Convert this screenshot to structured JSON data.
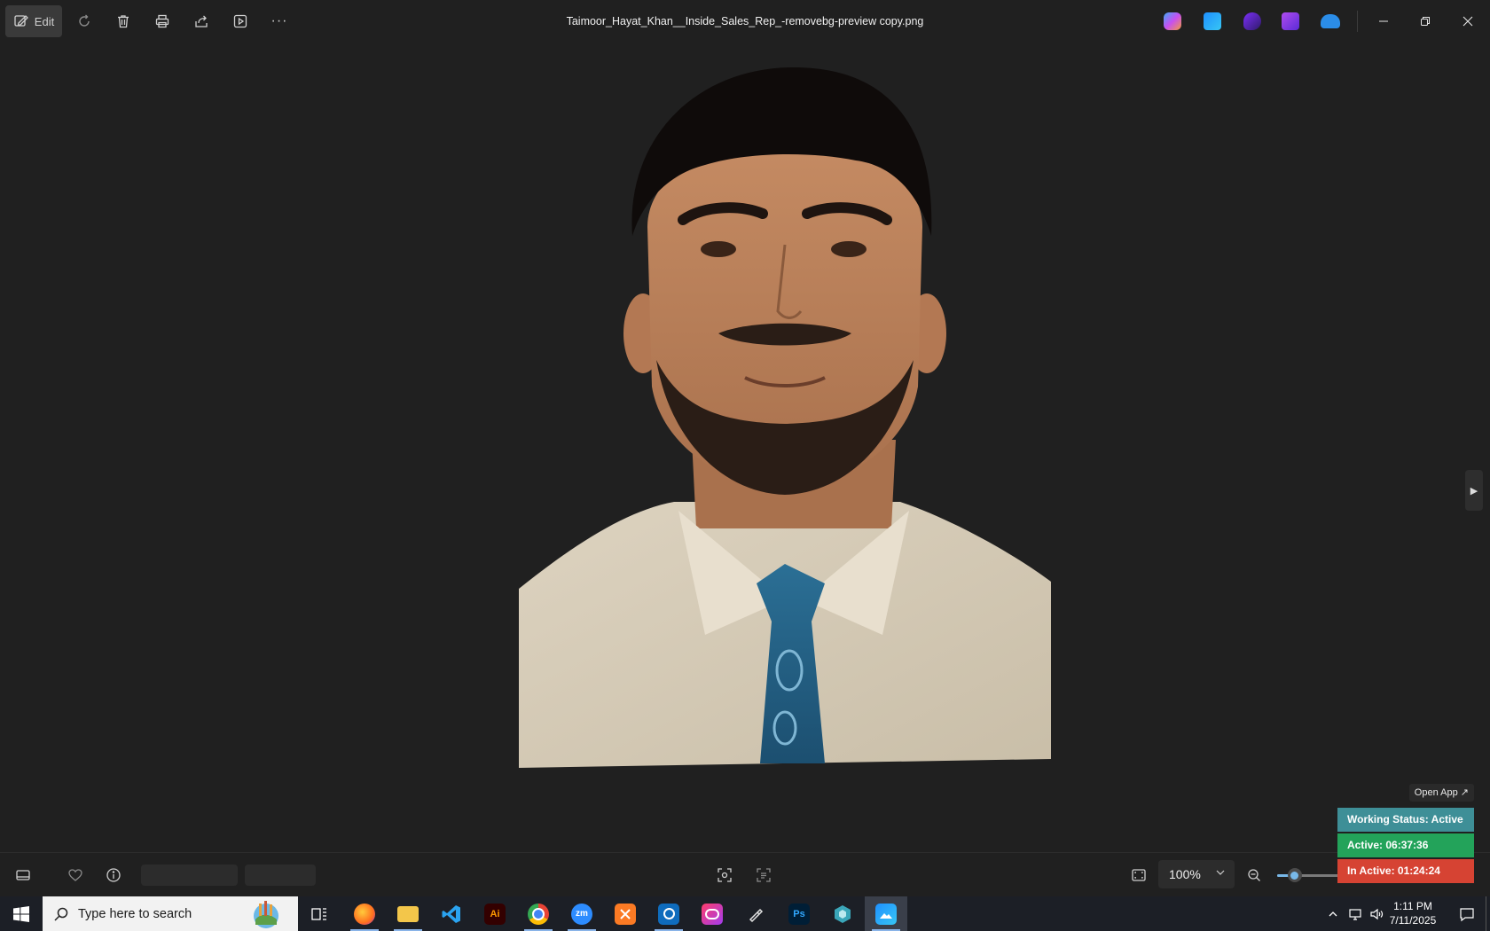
{
  "toolbar": {
    "edit_label": "Edit",
    "file_title": "Taimoor_Hayat_Khan__Inside_Sales_Rep_-removebg-preview copy.png",
    "more_label": "···"
  },
  "app_icons": [
    "copilot-icon",
    "photos-icon",
    "clipchamp-icon",
    "video-editor-icon",
    "onedrive-icon"
  ],
  "viewer": {
    "zoom_value": "100%",
    "zoom_slider_percent": 22
  },
  "widget": {
    "open_app": "Open App ↗",
    "working_status": "Working Status: Active",
    "active": "Active: 06:37:36",
    "inactive": "In Active: 01:24:24",
    "colors": {
      "status": "#3e8f97",
      "active": "#23a35a",
      "inactive": "#d64333"
    }
  },
  "taskbar": {
    "search_placeholder": "Type here to search",
    "apps": [
      "firefox-icon",
      "file-explorer-icon",
      "vscode-icon",
      "illustrator-icon",
      "chrome-icon",
      "zoom-icon",
      "xampp-icon",
      "outlook-icon",
      "creative-cloud-icon",
      "pen-tool-icon",
      "photoshop-icon",
      "app-icon",
      "photos-icon"
    ],
    "illustrator_label": "Ai",
    "zoom_label": "zm",
    "photoshop_label": "Ps",
    "time": "1:11 PM",
    "date": "7/11/2025"
  }
}
